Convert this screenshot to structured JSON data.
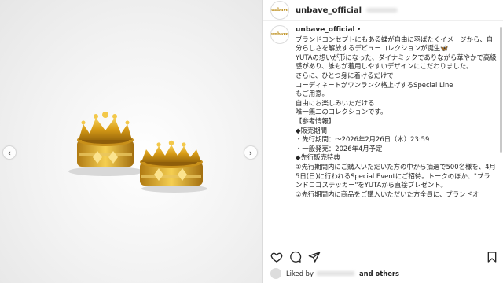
{
  "account": {
    "username": "unbave_official",
    "avatar_text": "unbave",
    "verified_mark": "•"
  },
  "caption": {
    "lines": [
      "ブランドコンセプトにもある蝶が自由に羽ばたくイメージから、自分らしさを解放するデビューコレクションが誕生🦋",
      "",
      "YUTAの想いが形になった、ダイナミックでありながら華やかで高級感があり、誰もが着用しやすいデザインにこだわりました。",
      "",
      "さらに、ひとつ身に着けるだけで",
      "コーディネートがワンランク格上げするSpecial Line",
      "もご用意。",
      "",
      "自由にお楽しみいただける",
      "唯一無二のコレクションです。",
      "",
      "【参考情報】",
      "◆販売期間",
      "・先行期間：～2026年2月26日（木）23:59",
      "・一般発売：2026年4月予定",
      "",
      "◆先行販売特典",
      "①先行期間内にご購入いただいた方の中から抽選で500名様を、4月5日(日)に行われるSpecial Eventにご招待。トークのほか、\"ブランドロゴステッカー\"をYUTAから直接プレゼント。",
      "②先行期間内に商品をご購入いただいた方全員に、ブランドオ"
    ]
  },
  "actions": {
    "like_icon": "heart-icon",
    "comment_icon": "comment-icon",
    "share_icon": "share-icon",
    "save_icon": "bookmark-icon"
  },
  "likes": {
    "prefix": "Liked by",
    "suffix": "and others"
  },
  "carousel": {
    "prev": "‹",
    "next": "›"
  },
  "colors": {
    "gold": "#d9a21b",
    "gold_dark": "#a87410",
    "text": "#262626"
  }
}
